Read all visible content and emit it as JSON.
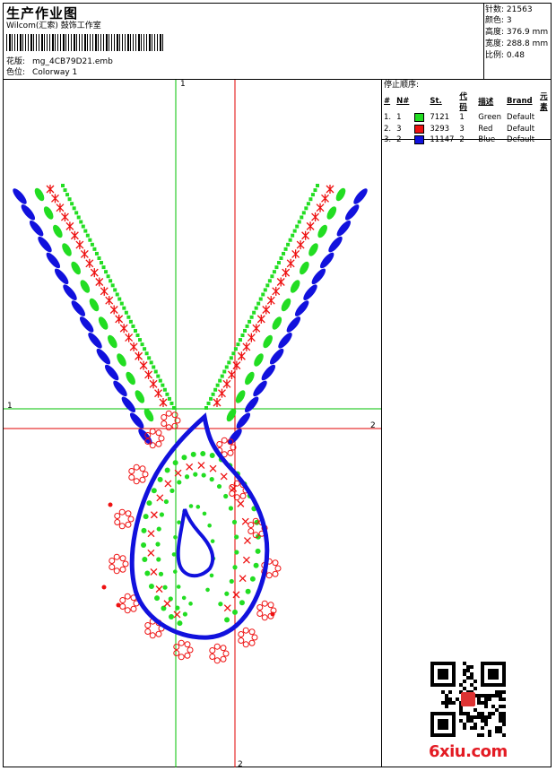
{
  "header": {
    "title": "生产作业图",
    "company": "Wilcom(汇索) 鼓饰工作室",
    "pattern_label": "花版:",
    "pattern_value": "mg_4CB79D21.emb",
    "colorway_label": "色位:",
    "colorway_value": "Colorway 1"
  },
  "stats": [
    {
      "label": "针数:",
      "value": "21563"
    },
    {
      "label": "颜色:",
      "value": "3"
    },
    {
      "label": "高度:",
      "value": "376.9 mm"
    },
    {
      "label": "宽度:",
      "value": "288.8 mm"
    },
    {
      "label": "比例:",
      "value": "0.48"
    }
  ],
  "stop_sequence": {
    "heading": "停止顺序:",
    "columns": [
      "#",
      "N#",
      "St.",
      "代码",
      "描述",
      "Brand",
      "元素"
    ],
    "rows": [
      {
        "num": "1.",
        "n": "1",
        "color": "#22dd22",
        "stitches": "7121",
        "code": "1",
        "desc": "Green",
        "brand": "Default"
      },
      {
        "num": "2.",
        "n": "3",
        "color": "#ee1111",
        "stitches": "3293",
        "code": "3",
        "desc": "Red",
        "brand": "Default"
      },
      {
        "num": "3.",
        "n": "2",
        "color": "#1111dd",
        "stitches": "11147",
        "code": "2",
        "desc": "Blue",
        "brand": "Default"
      }
    ]
  },
  "axes": {
    "green_top": "1",
    "green_left": "1",
    "red_right": "2",
    "red_bottom": "2"
  },
  "colors": {
    "green": "#22dd22",
    "red": "#ee1111",
    "blue": "#1111dd",
    "guide_green": "#00c000",
    "guide_red": "#e00000"
  },
  "watermark": "6xiu.com"
}
